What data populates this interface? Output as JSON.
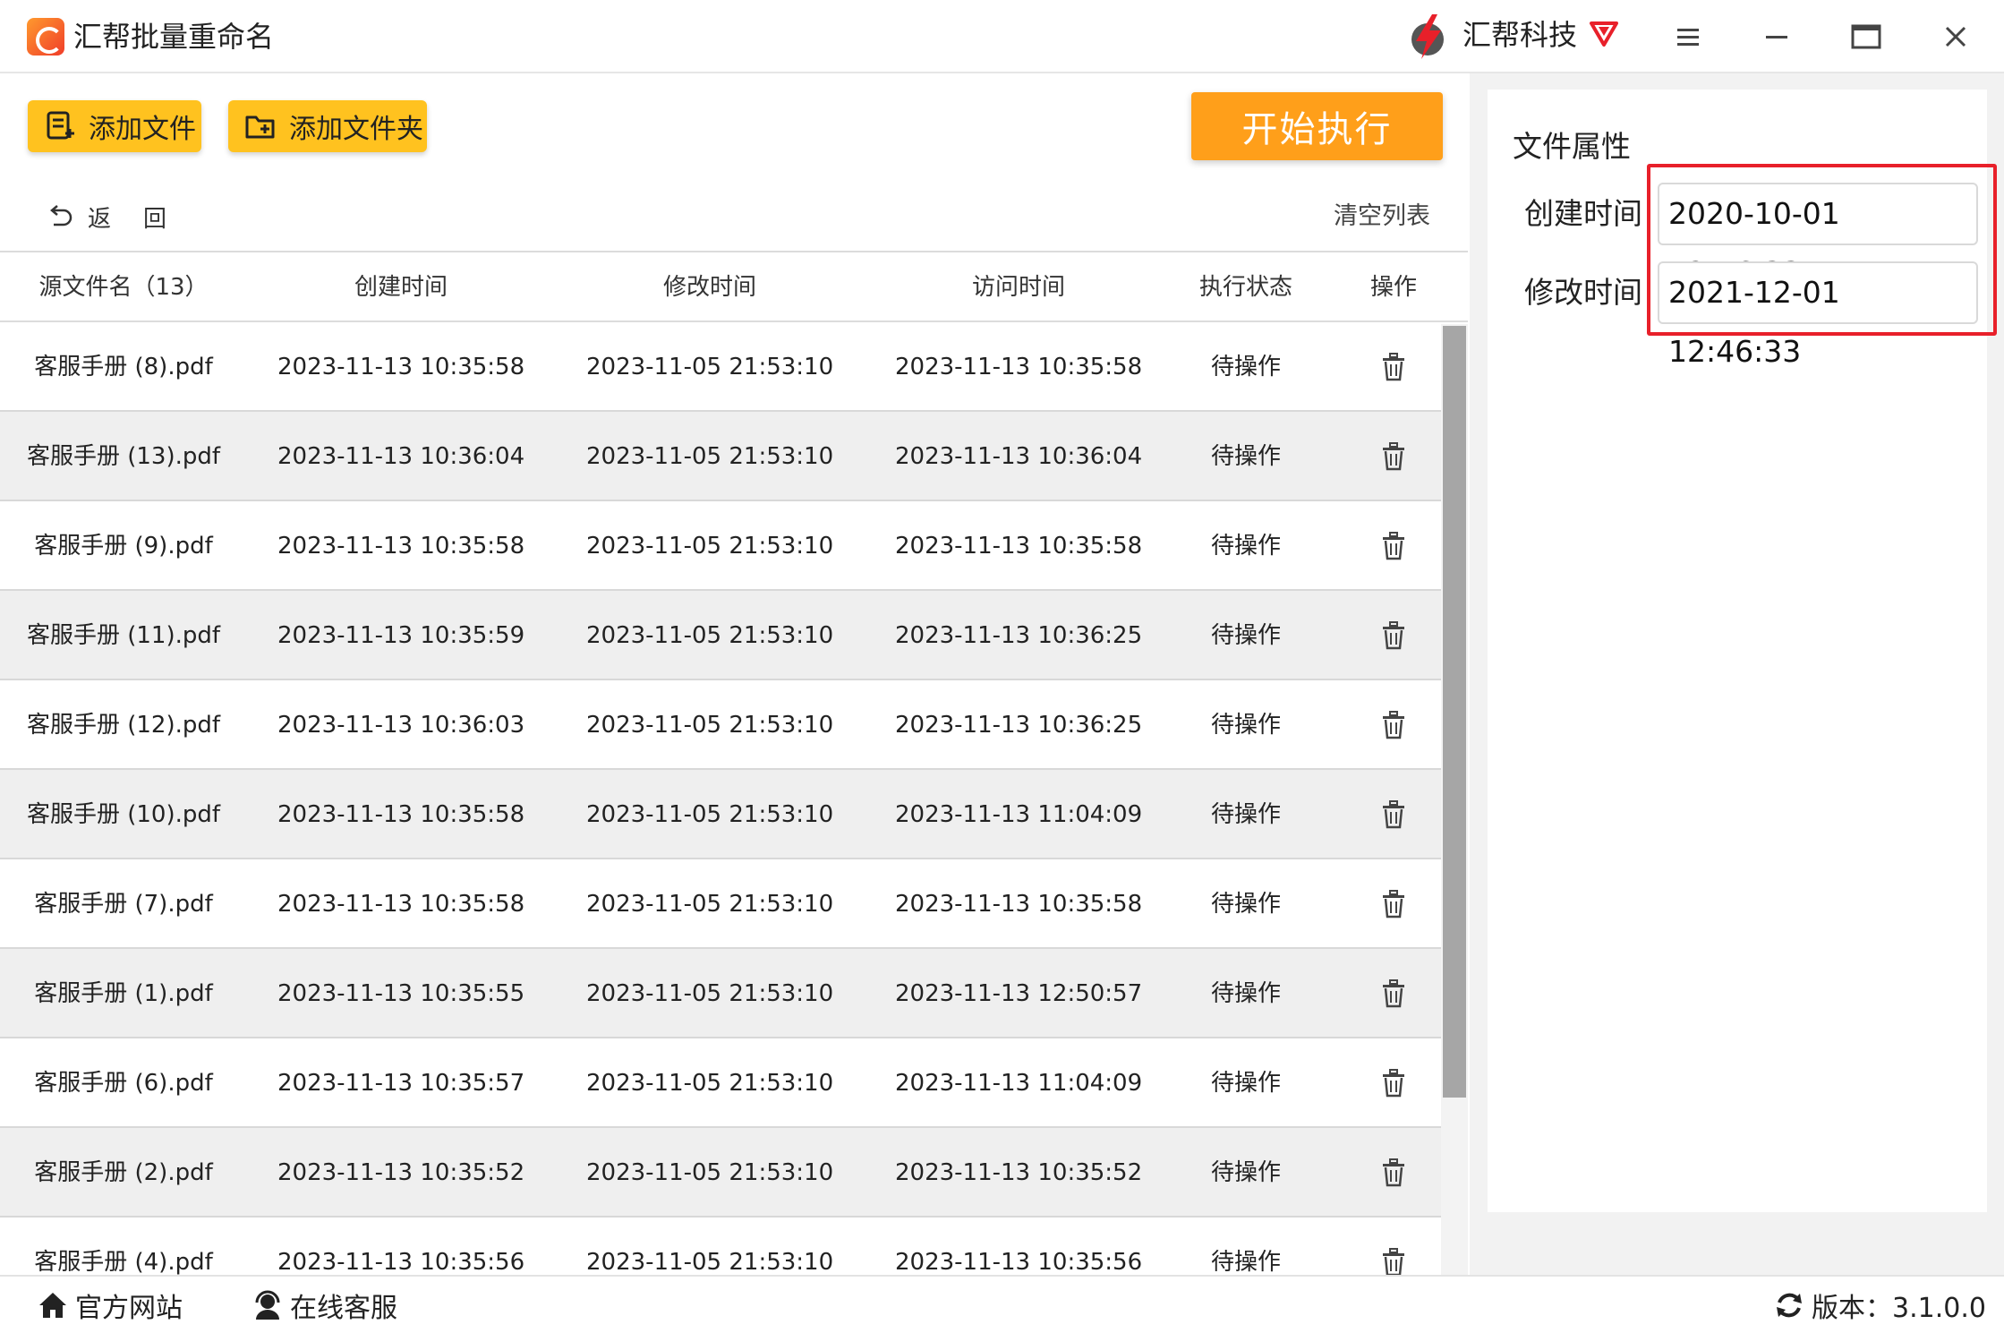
{
  "window": {
    "title": "汇帮批量重命名",
    "brand_name": "汇帮科技",
    "colors": {
      "accent": "#ffc21f",
      "primary_action": "#ff9f1a",
      "highlight": "#e8202a",
      "vip": "#e8202a"
    }
  },
  "toolbar": {
    "add_file_label": "添加文件",
    "add_folder_label": "添加文件夹",
    "start_label": "开始执行",
    "back_label": "返回",
    "clear_list_label": "清空列表"
  },
  "table": {
    "headers": {
      "name": "源文件名（13）",
      "created": "创建时间",
      "modified": "修改时间",
      "accessed": "访问时间",
      "status": "执行状态",
      "action": "操作"
    },
    "rows": [
      {
        "name": "客服手册 (8).pdf",
        "created": "2023-11-13 10:35:58",
        "modified": "2023-11-05 21:53:10",
        "accessed": "2023-11-13 10:35:58",
        "status": "待操作"
      },
      {
        "name": "客服手册 (13).pdf",
        "created": "2023-11-13 10:36:04",
        "modified": "2023-11-05 21:53:10",
        "accessed": "2023-11-13 10:36:04",
        "status": "待操作"
      },
      {
        "name": "客服手册 (9).pdf",
        "created": "2023-11-13 10:35:58",
        "modified": "2023-11-05 21:53:10",
        "accessed": "2023-11-13 10:35:58",
        "status": "待操作"
      },
      {
        "name": "客服手册 (11).pdf",
        "created": "2023-11-13 10:35:59",
        "modified": "2023-11-05 21:53:10",
        "accessed": "2023-11-13 10:36:25",
        "status": "待操作"
      },
      {
        "name": "客服手册 (12).pdf",
        "created": "2023-11-13 10:36:03",
        "modified": "2023-11-05 21:53:10",
        "accessed": "2023-11-13 10:36:25",
        "status": "待操作"
      },
      {
        "name": "客服手册 (10).pdf",
        "created": "2023-11-13 10:35:58",
        "modified": "2023-11-05 21:53:10",
        "accessed": "2023-11-13 11:04:09",
        "status": "待操作"
      },
      {
        "name": "客服手册 (7).pdf",
        "created": "2023-11-13 10:35:58",
        "modified": "2023-11-05 21:53:10",
        "accessed": "2023-11-13 10:35:58",
        "status": "待操作"
      },
      {
        "name": "客服手册 (1).pdf",
        "created": "2023-11-13 10:35:55",
        "modified": "2023-11-05 21:53:10",
        "accessed": "2023-11-13 12:50:57",
        "status": "待操作"
      },
      {
        "name": "客服手册 (6).pdf",
        "created": "2023-11-13 10:35:57",
        "modified": "2023-11-05 21:53:10",
        "accessed": "2023-11-13 11:04:09",
        "status": "待操作"
      },
      {
        "name": "客服手册 (2).pdf",
        "created": "2023-11-13 10:35:52",
        "modified": "2023-11-05 21:53:10",
        "accessed": "2023-11-13 10:35:52",
        "status": "待操作"
      },
      {
        "name": "客服手册 (4).pdf",
        "created": "2023-11-13 10:35:56",
        "modified": "2023-11-05 21:53:10",
        "accessed": "2023-11-13 10:35:56",
        "status": "待操作"
      }
    ]
  },
  "attributes": {
    "title": "文件属性",
    "created_label": "创建时间",
    "created_value": "2020-10-01 12:46:33",
    "modified_label": "修改时间",
    "modified_value": "2021-12-01 12:46:33"
  },
  "footer": {
    "official_site_label": "官方网站",
    "online_service_label": "在线客服",
    "version_label": "版本：3.1.0.0"
  },
  "icons": {
    "app": "app-logo-icon",
    "brand": "brand-lightning-icon",
    "vip": "vip-diamond-icon",
    "add_file": "add-file-icon",
    "add_folder": "add-folder-icon",
    "back": "undo-arrow-icon",
    "delete": "trash-icon",
    "home": "home-icon",
    "service": "headset-icon",
    "refresh": "refresh-icon"
  }
}
